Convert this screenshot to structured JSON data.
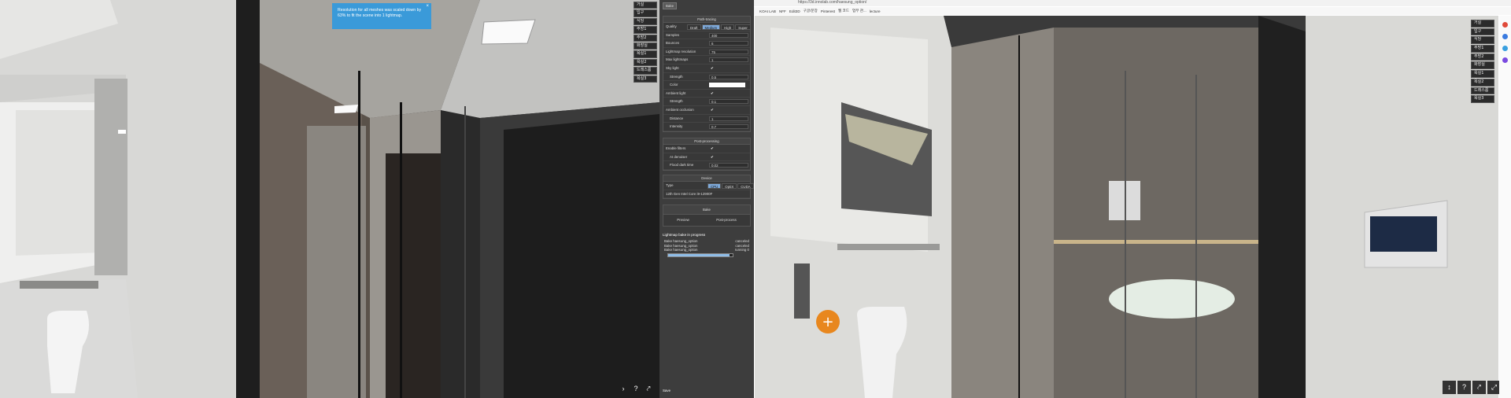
{
  "left_viewer": {
    "toast": {
      "message": "Resolution for all meshes was scaled down by 63% to fit the scene into 1 lightmap.",
      "close_glyph": "×"
    },
    "room_menu": [
      "거실",
      "입구",
      "식당",
      "주방1",
      "주방2",
      "화장실",
      "욕실1",
      "욕실2",
      "드레스룸",
      "욕실3"
    ],
    "tools": {
      "arrow": "›",
      "help": "?",
      "path": "⤤"
    }
  },
  "bake_panel": {
    "tab": "Bake",
    "path_tracing": {
      "title": "Path-tracing",
      "quality_label": "Quality",
      "quality_options": [
        "Draft",
        "Medium",
        "High",
        "Super"
      ],
      "quality_selected": "Medium",
      "samples_label": "Samples",
      "samples_value": "400",
      "bounces_label": "Bounces",
      "bounces_value": "6",
      "resolution_label": "Lightmap resolution",
      "resolution_value": "75",
      "max_lightmaps_label": "Max lightmaps",
      "max_lightmaps_value": "1",
      "sky_light_label": "Sky light",
      "sky_light_checked": "✔",
      "strength_label": "Strength",
      "strength_value": "0.5",
      "color_label": "Color",
      "ambient_label": "Ambient light",
      "ambient_checked": "✔",
      "ambient_strength_label": "Strength",
      "ambient_strength_value": "0.1",
      "ao_label": "Ambient occlusion",
      "ao_checked": "✔",
      "distance_label": "Distance",
      "distance_value": "1",
      "intensity_label": "Intensity",
      "intensity_value": "0.7"
    },
    "post_processing": {
      "title": "Post-processing",
      "enable_filters_label": "Enable filters",
      "enable_filters_checked": "✔",
      "denoiser_label": "AI denoiser",
      "denoiser_checked": "✔",
      "flood_label": "Flood dark time",
      "flood_value": "0.02"
    },
    "device": {
      "title": "Device",
      "type_label": "Type",
      "type_options": [
        "CPU",
        "OptiX",
        "CUDA"
      ],
      "type_selected": "CPU",
      "device_name": "12th Gen Intel Core i9-12900F"
    },
    "bake": {
      "title": "Bake",
      "preview_button": "Preview",
      "postprocess_button": "Post-process"
    },
    "progress": {
      "title": "Lightmap bake in progress",
      "log": [
        {
          "name": "Bake haesung_option",
          "status": "canceled"
        },
        {
          "name": "Bake haesung_option",
          "status": "canceled"
        },
        {
          "name": "Bake haesung_option",
          "status": "running 0"
        }
      ],
      "fraction": 0.95
    },
    "save_button": "Save"
  },
  "browser": {
    "url": "https://3d.innolab.com/haesung_option/",
    "bookmarks": [
      "KOAI LAB",
      "NFF",
      "Edit3D",
      "구글/문장",
      "Pinterest",
      "웹 코드",
      "업무 관...",
      "lecture"
    ],
    "room_menu": [
      "거실",
      "입구",
      "식당",
      "주방1",
      "주방2",
      "화장실",
      "욕실1",
      "욕실2",
      "드레스룸",
      "욕실3"
    ],
    "tools": {
      "nav": "↕",
      "help": "?",
      "path": "⤤",
      "fullscreen": "⤢"
    },
    "hotspot_glyph": "+"
  },
  "colors": {
    "accent": "#3a9ad9",
    "panel_bg": "#3d3d3d",
    "selected": "#7ea9d9",
    "hotspot": "#e8871e"
  }
}
